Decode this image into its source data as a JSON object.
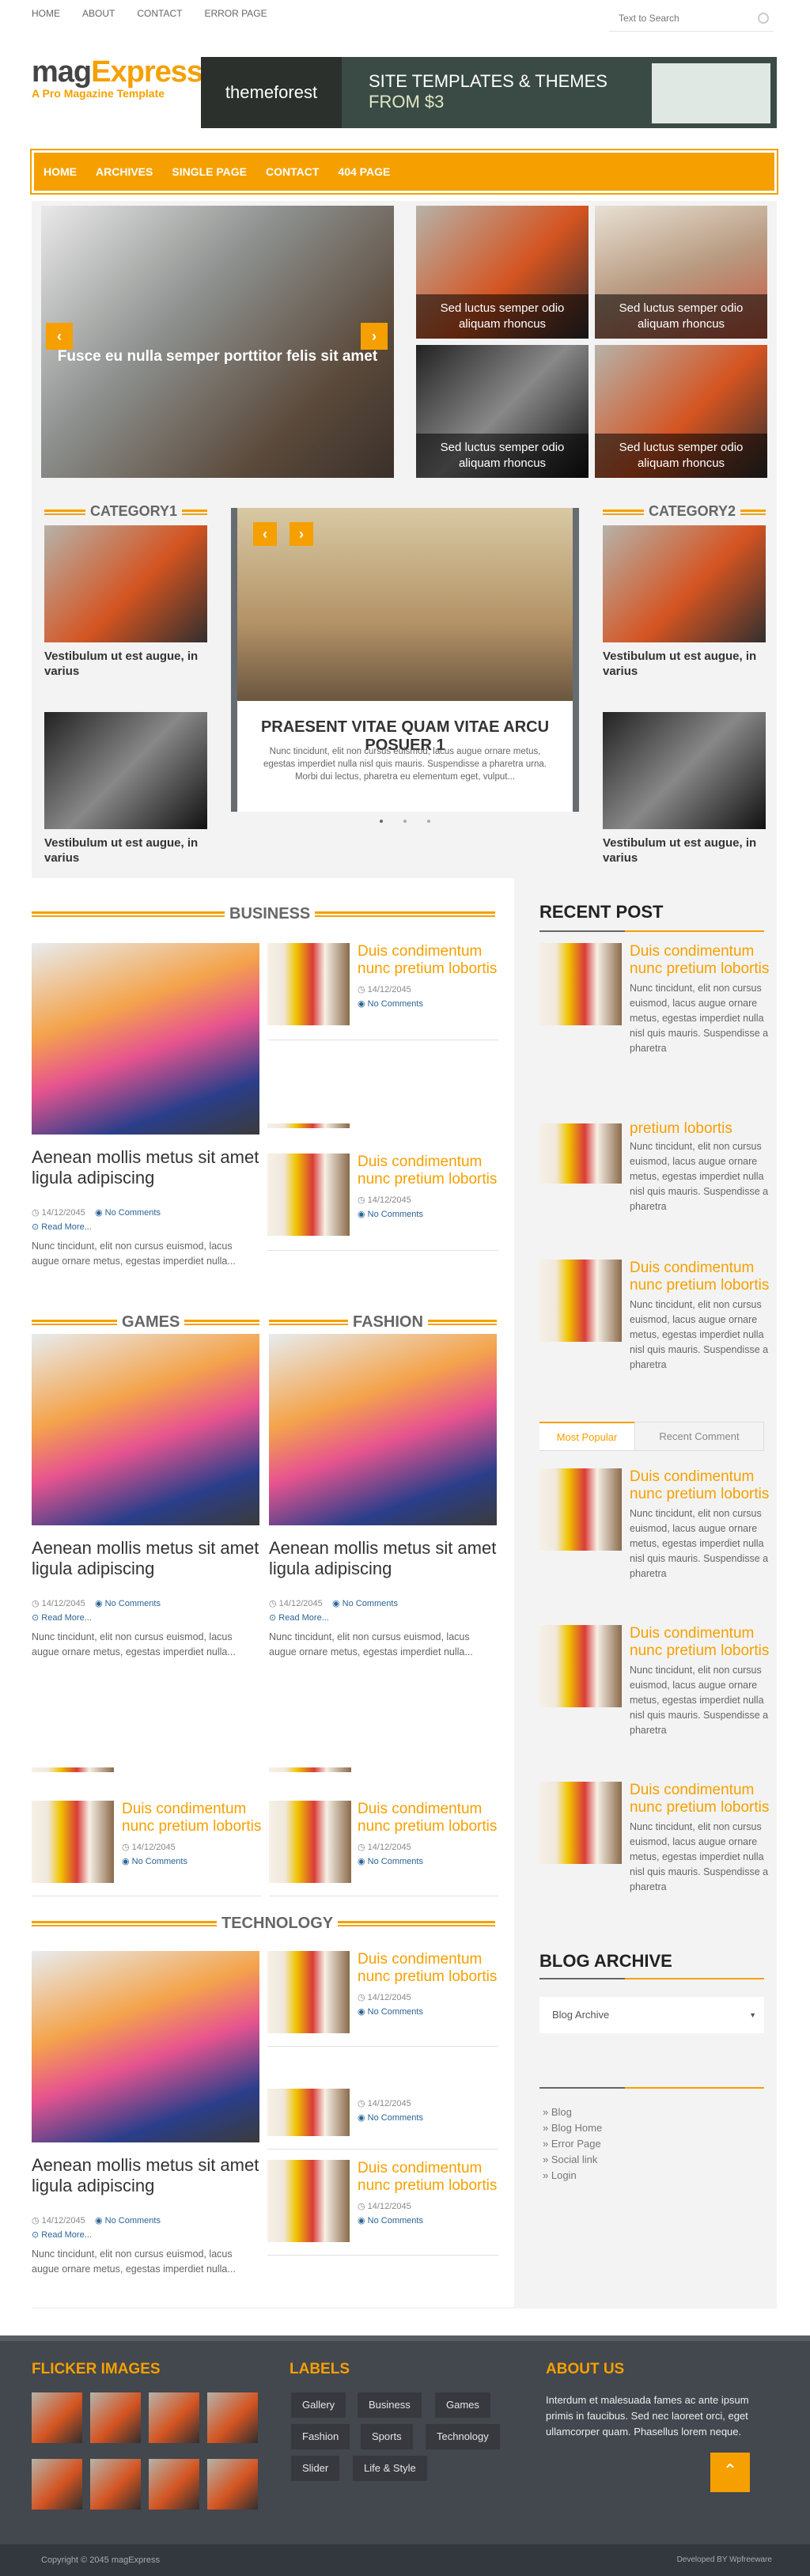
{
  "top": {
    "links": [
      "HOME",
      "ABOUT",
      "CONTACT",
      "ERROR PAGE"
    ],
    "search_placeholder": "Text to Search"
  },
  "brand": {
    "part1": "mag",
    "part2": "Express",
    "tagline": "A Pro Magazine Template",
    "ad_logo": "themeforest",
    "ad_text1": "SITE TEMPLATES & THEMES",
    "ad_text2": "FROM $3"
  },
  "nav": [
    "HOME",
    "ARCHIVES",
    "SINGLE PAGE",
    "CONTACT",
    "404 PAGE"
  ],
  "slider": {
    "main": "Fusce eu nulla semper porttitor felis sit amet",
    "tiles": [
      "Sed luctus semper odio aliquam rhoncus",
      "Sed luctus semper odio aliquam rhoncus",
      "Sed luctus semper odio aliquam rhoncus",
      "Sed luctus semper odio aliquam rhoncus"
    ]
  },
  "cat1": {
    "title": "CATEGORY1",
    "items": [
      "Vestibulum ut est augue, in varius",
      "Vestibulum ut est augue, in varius"
    ]
  },
  "cat2": {
    "title": "CATEGORY2",
    "items": [
      "Vestibulum ut est augue, in varius",
      "Vestibulum ut est augue, in varius"
    ]
  },
  "center": {
    "title": "PRAESENT VITAE QUAM VITAE ARCU POSUER 1",
    "text": "Nunc tincidunt, elit non cursus euismod, lacus augue ornare metus, egestas imperdiet nulla nisl quis mauris. Suspendisse a pharetra urna. Morbi dui lectus, pharetra eu elementum eget, vulput..."
  },
  "sections": {
    "business": "BUSINESS",
    "games": "GAMES",
    "fashion": "FASHION",
    "technology": "TECHNOLOGY"
  },
  "post": {
    "title": "Aenean mollis metus sit amet ligula adipiscing",
    "date": "14/12/2045",
    "comments": "No Comments",
    "more": "Read More...",
    "excerpt": "Nunc tincidunt, elit non cursus euismod, lacus augue ornare metus, egestas imperdiet nulla..."
  },
  "small": {
    "title": "Duis condimentum nunc pretium lobortis",
    "date": "14/12/2045",
    "comments": "No Comments",
    "title_cut": "pretium lobortis"
  },
  "side": {
    "recent": "RECENT POST",
    "text": "Nunc tincidunt, elit non cursus euismod, lacus augue ornare metus, egestas imperdiet nulla nisl quis mauris. Suspendisse a pharetra",
    "tab1": "Most Popular",
    "tab2": "Recent Comment",
    "archive": "BLOG ARCHIVE",
    "archive_select": "Blog Archive",
    "links": [
      "Blog",
      "Blog Home",
      "Error Page",
      "Social link",
      "Login"
    ]
  },
  "footer": {
    "flicker": "FLICKER IMAGES",
    "labels": "LABELS",
    "about": "ABOUT US",
    "tags": [
      "Gallery",
      "Business",
      "Games",
      "Fashion",
      "Sports",
      "Technology",
      "Slider",
      "Life & Style"
    ],
    "about_text": "Interdum et malesuada fames ac ante ipsum primis in faucibus. Sed nec laoreet orci, eget ullamcorper quam. Phasellus lorem neque.",
    "copyright": "Copyright © 2045 magExpress",
    "dev": "Developed BY Wpfreeware"
  }
}
